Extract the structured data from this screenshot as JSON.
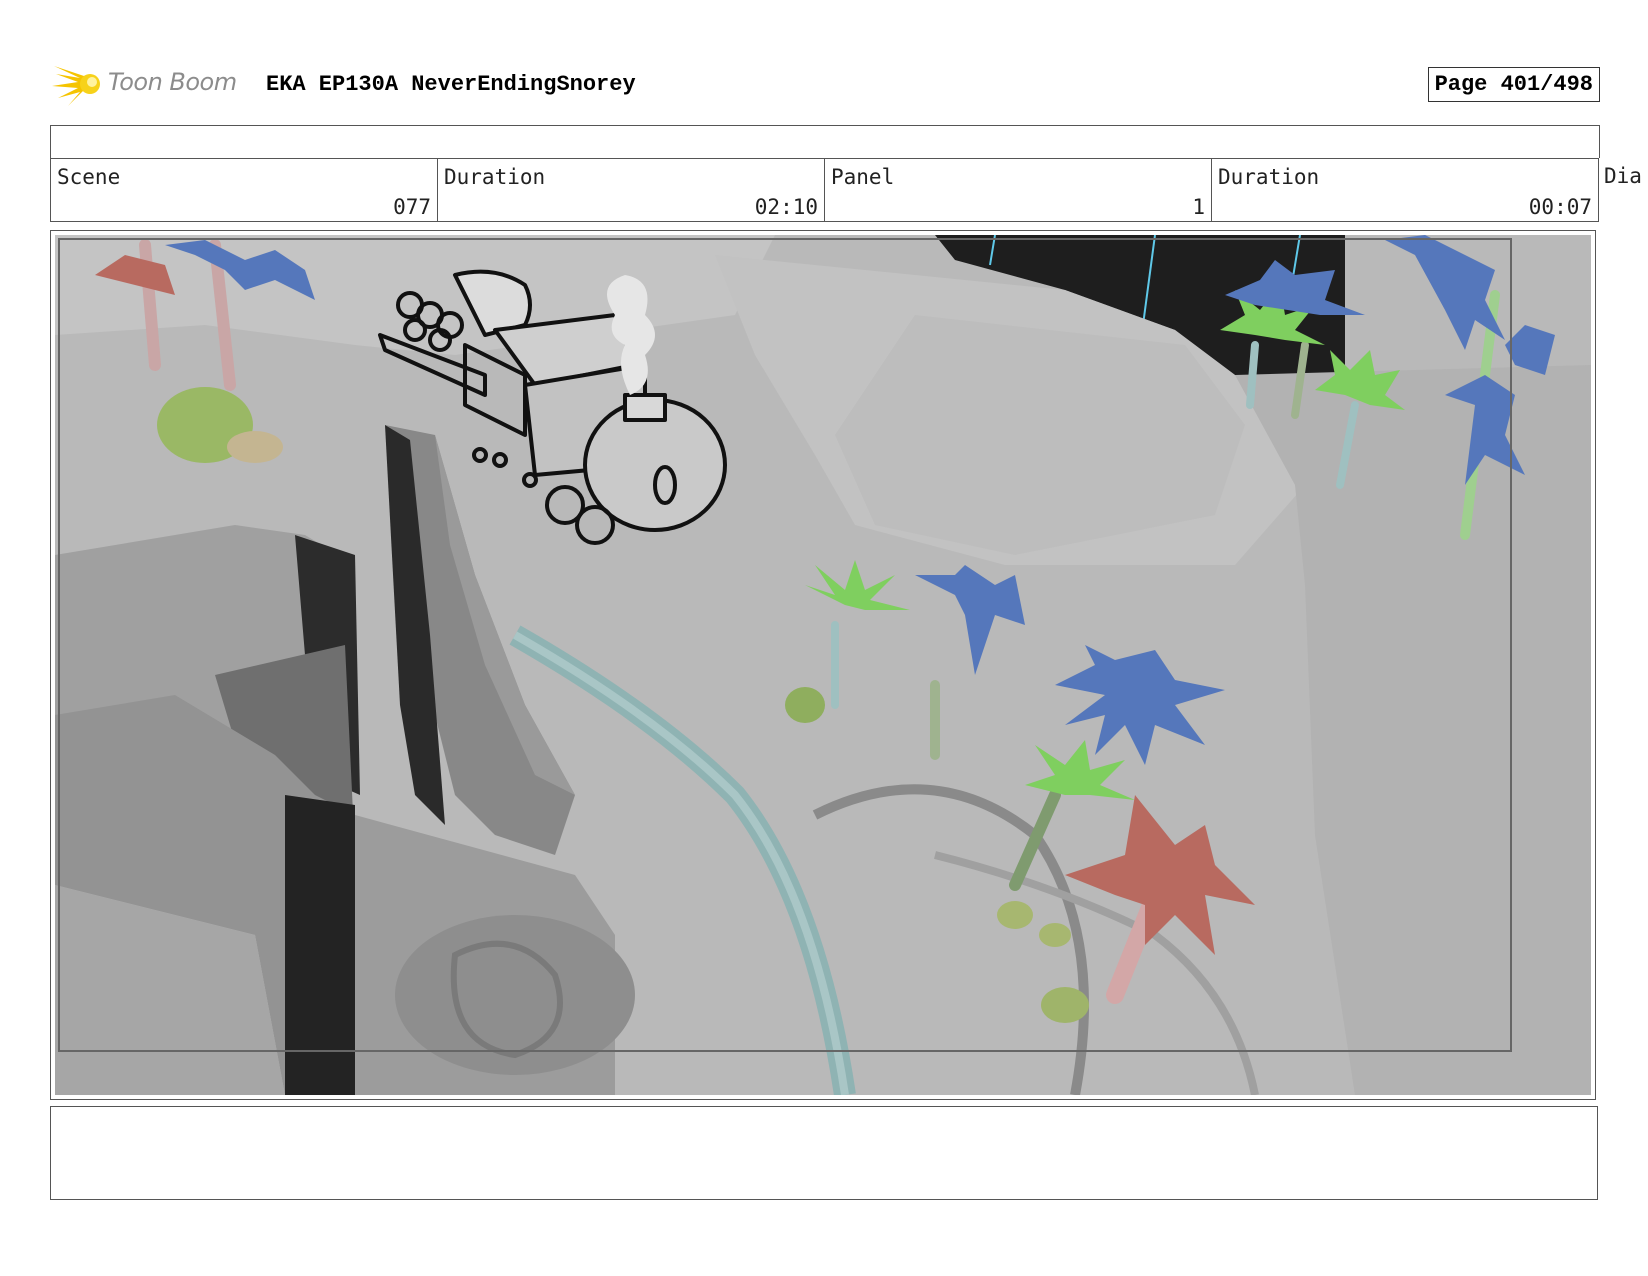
{
  "header": {
    "logo_text": "Toon Boom",
    "title": "EKA EP130A NeverEndingSnorey",
    "page_label": "Page 401/498"
  },
  "info": {
    "scene_label": "Scene",
    "scene_value": "077",
    "scene_duration_label": "Duration",
    "scene_duration_value": "02:10",
    "panel_label": "Panel",
    "panel_value": "1",
    "panel_duration_label": "Duration",
    "panel_duration_value": "00:07",
    "dialogue_label": "Dia"
  },
  "colors": {
    "logo_accent": "#f5c400",
    "palm_green": "#7fcf5f",
    "palm_blue": "#5577bb",
    "palm_red": "#b86a60",
    "rock_grey": "#a8a8a8",
    "water": "#8fb3b3"
  },
  "icons": {
    "logo": "toon-boom-starburst-icon"
  }
}
